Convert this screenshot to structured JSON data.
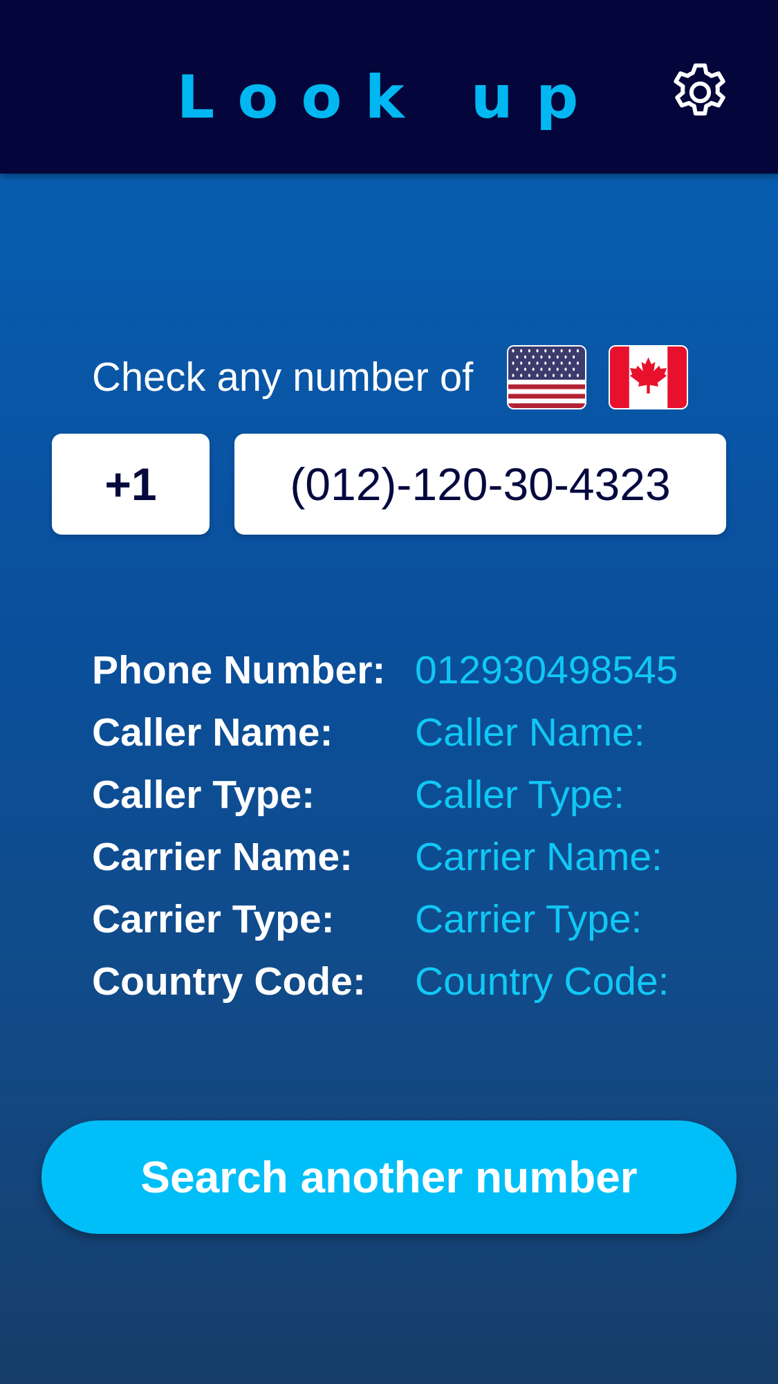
{
  "header": {
    "title": "Look up",
    "settings_icon": "gear-icon"
  },
  "intro": {
    "label": "Check any number of",
    "flags": [
      "us-flag-icon",
      "canada-flag-icon"
    ]
  },
  "input": {
    "country_code": "+1",
    "phone_number": "(012)-120-30-4323"
  },
  "results": [
    {
      "label": "Phone Number:",
      "value": "012930498545"
    },
    {
      "label": "Caller Name:",
      "value": "Caller Name:"
    },
    {
      "label": "Caller Type:",
      "value": "Caller Type:"
    },
    {
      "label": "Carrier Name:",
      "value": "Carrier Name:"
    },
    {
      "label": "Carrier Type:",
      "value": "Carrier Type:"
    },
    {
      "label": "Country Code:",
      "value": "Country Code:"
    }
  ],
  "actions": {
    "search_another_label": "Search another number"
  },
  "colors": {
    "header_bg": "#04053a",
    "title": "#00b7f2",
    "value_text": "#10c8f5",
    "button_bg": "#00bff8",
    "field_text": "#06093e"
  }
}
